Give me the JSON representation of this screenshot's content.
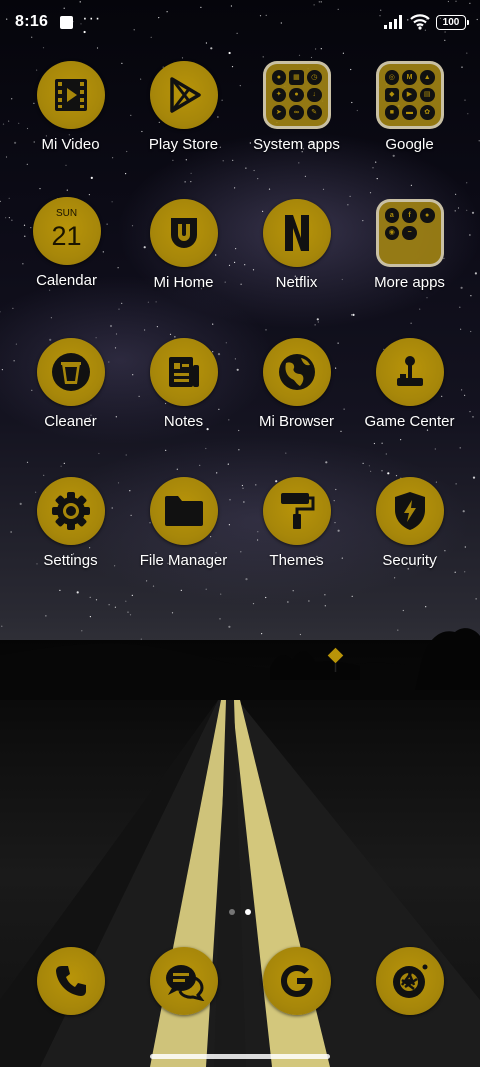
{
  "status_bar": {
    "time": "8:16",
    "more_indicator": "···",
    "battery": "100",
    "icons": [
      "notification-square-icon",
      "signal-icon",
      "wifi-icon",
      "battery-icon"
    ]
  },
  "apps": [
    {
      "label": "Mi Video",
      "icon": "video-icon"
    },
    {
      "label": "Play Store",
      "icon": "play-store-icon"
    },
    {
      "label": "System apps",
      "icon": "folder-icon"
    },
    {
      "label": "Google",
      "icon": "folder-icon"
    },
    {
      "label": "Calendar",
      "icon": "calendar-icon",
      "day": "SUN",
      "date": "21"
    },
    {
      "label": "Mi Home",
      "icon": "mi-home-icon"
    },
    {
      "label": "Netflix",
      "icon": "netflix-icon"
    },
    {
      "label": "More apps",
      "icon": "folder-icon"
    },
    {
      "label": "Cleaner",
      "icon": "trash-icon"
    },
    {
      "label": "Notes",
      "icon": "notes-icon"
    },
    {
      "label": "Mi Browser",
      "icon": "globe-icon"
    },
    {
      "label": "Game Center",
      "icon": "joystick-icon"
    },
    {
      "label": "Settings",
      "icon": "gear-icon"
    },
    {
      "label": "File Manager",
      "icon": "folder-file-icon"
    },
    {
      "label": "Themes",
      "icon": "paint-roller-icon"
    },
    {
      "label": "Security",
      "icon": "shield-bolt-icon"
    }
  ],
  "dock": [
    {
      "icon": "phone-icon"
    },
    {
      "icon": "messages-icon"
    },
    {
      "icon": "google-icon"
    },
    {
      "icon": "camera-icon"
    }
  ],
  "pages": {
    "count": 2,
    "current": 2
  },
  "colors": {
    "icon_gold": "#a7870a",
    "icon_glyph": "#111111"
  }
}
